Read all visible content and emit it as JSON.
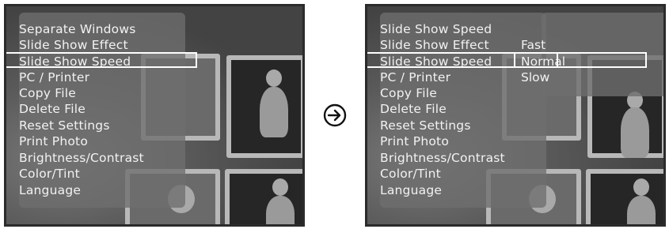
{
  "left_screen": {
    "menu_items": [
      "Separate Windows",
      "Slide Show Effect",
      "Slide Show Speed",
      "PC / Printer",
      "Copy File",
      "Delete File",
      "Reset Settings",
      "Print Photo",
      "Brightness/Contrast",
      "Color/Tint",
      "Language"
    ],
    "selected_index": 2
  },
  "right_screen": {
    "menu_items": [
      "Slide Show Speed",
      "Slide Show Effect",
      "Slide Show Speed",
      "PC / Printer",
      "Copy File",
      "Delete File",
      "Reset Settings",
      "Print Photo",
      "Brightness/Contrast",
      "Color/Tint",
      "Language"
    ],
    "selected_index": 2,
    "submenu_items": [
      "Fast",
      "Normal",
      "Slow"
    ],
    "submenu_selected_index": 1
  },
  "transition_icon": "circled-arrow-right-icon"
}
